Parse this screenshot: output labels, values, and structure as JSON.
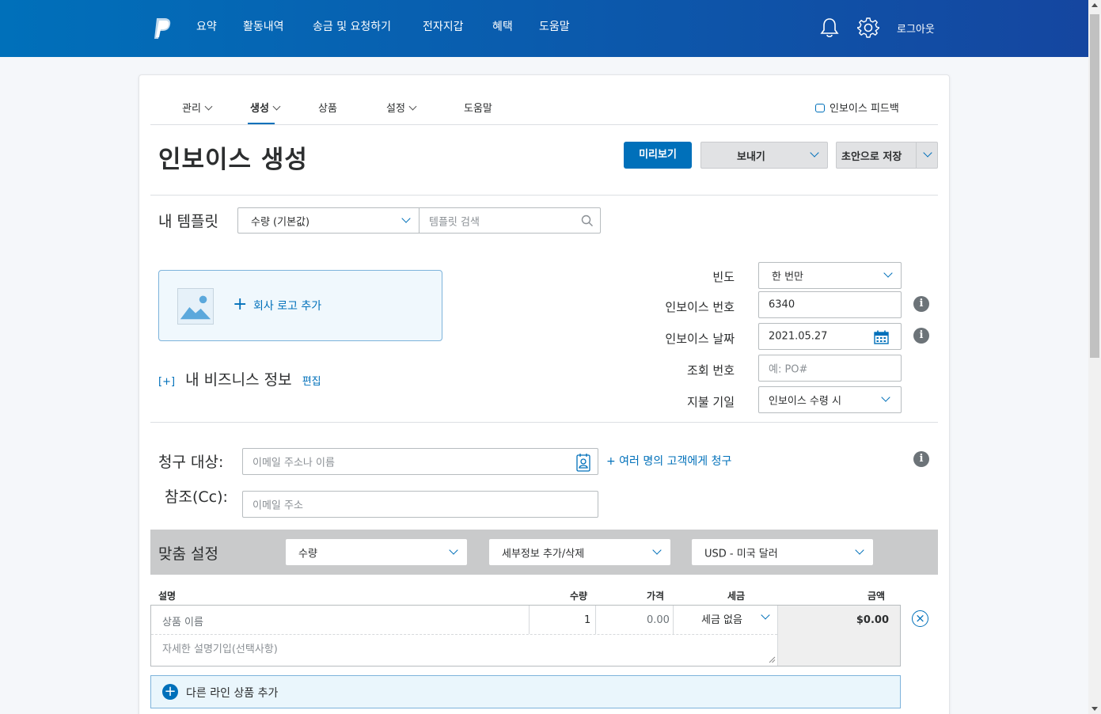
{
  "topnav": {
    "items": [
      "요약",
      "활동내역",
      "송금 및 요청하기",
      "전자지갑",
      "혜택",
      "도움말"
    ],
    "logout": "로그아웃"
  },
  "subnav": {
    "manage": "관리",
    "create": "생성",
    "products": "상품",
    "settings": "설정",
    "help": "도움말",
    "feedback": "인보이스 피드백"
  },
  "page": {
    "title": "인보이스 생성",
    "preview_button": "미리보기",
    "send_button": "보내기",
    "save_draft_button": "초안으로 저장"
  },
  "templates": {
    "label": "내 템플릿",
    "selected": "수량 (기본값)",
    "search_placeholder": "템플릿 검색"
  },
  "logo": {
    "add_label": "회사 로고 추가"
  },
  "business": {
    "toggle": "[+]",
    "label": "내 비즈니스 정보",
    "edit": "편집"
  },
  "details": {
    "frequency_label": "빈도",
    "frequency_value": "한 번만",
    "invoice_number_label": "인보이스 번호",
    "invoice_number_value": "6340",
    "invoice_date_label": "인보이스 날짜",
    "invoice_date_value": "2021.05.27",
    "reference_label": "조회 번호",
    "reference_placeholder": "예: PO#",
    "due_label": "지불 기일",
    "due_value": "인보이스 수령 시"
  },
  "billing": {
    "bill_to_label": "청구 대상:",
    "bill_to_placeholder": "이메일 주소나 이름",
    "multi_link": "+ 여러 명의 고객에게 청구",
    "cc_label": "참조(Cc):",
    "cc_placeholder": "이메일 주소"
  },
  "customize": {
    "label": "맞춤 설정",
    "quantity_select": "수량",
    "details_select": "세부정보 추가/삭제",
    "currency_select": "USD - 미국 달러"
  },
  "items": {
    "headers": {
      "description": "설명",
      "quantity": "수량",
      "price": "가격",
      "tax": "세금",
      "amount": "금액"
    },
    "row": {
      "name_placeholder": "상품 이름",
      "quantity": "1",
      "price_placeholder": "0.00",
      "tax": "세금 없음",
      "amount": "$0.00",
      "detail_placeholder": "자세한 설명기입(선택사항)"
    },
    "add_line": "다른 라인 상품 추가"
  },
  "colors": {
    "brand_blue": "#0070ba",
    "nav_gradient_end": "#1546a0"
  }
}
